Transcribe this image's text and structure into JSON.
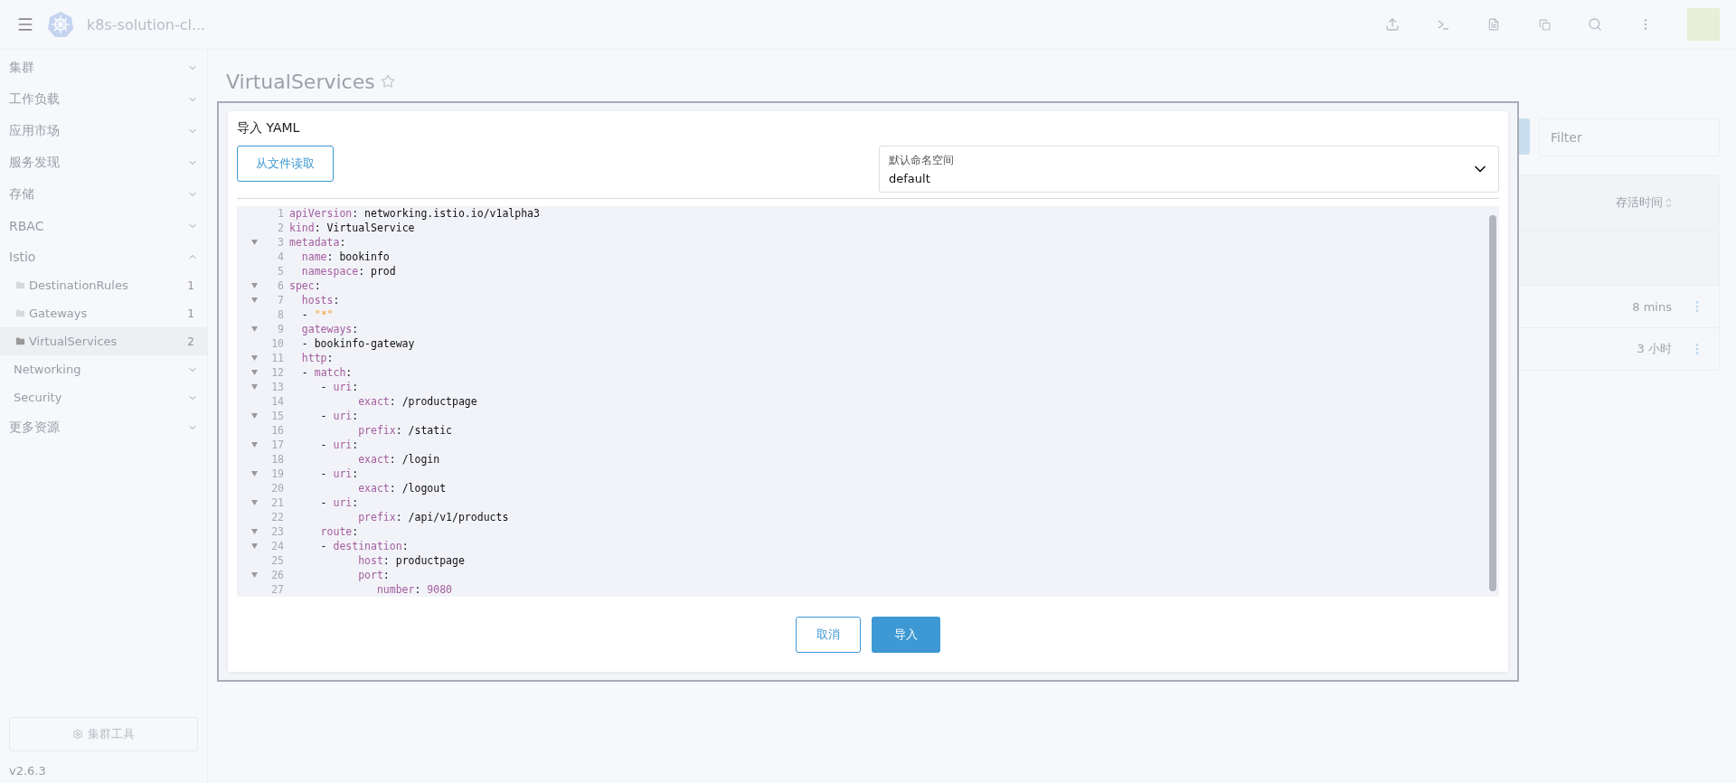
{
  "header": {
    "app_name": "k8s-solution-cl..."
  },
  "sidebar": {
    "items": [
      {
        "label": "集群",
        "expanded": false
      },
      {
        "label": "工作负载",
        "expanded": false
      },
      {
        "label": "应用市场",
        "expanded": false
      },
      {
        "label": "服务发现",
        "expanded": false
      },
      {
        "label": "存储",
        "expanded": false
      },
      {
        "label": "RBAC",
        "expanded": false
      },
      {
        "label": "Istio",
        "expanded": true,
        "children": [
          {
            "kind": "resource",
            "label": "DestinationRules",
            "count": "1",
            "selected": false
          },
          {
            "kind": "resource",
            "label": "Gateways",
            "count": "1",
            "selected": false
          },
          {
            "kind": "resource",
            "label": "VirtualServices",
            "count": "2",
            "selected": true
          },
          {
            "kind": "group",
            "label": "Networking",
            "expanded": false
          },
          {
            "kind": "group",
            "label": "Security",
            "expanded": false
          }
        ]
      },
      {
        "label": "更多资源",
        "expanded": false
      }
    ],
    "tool_button": "集群工具",
    "version": "v2.6.3"
  },
  "page": {
    "title": "VirtualServices",
    "starred": false,
    "filter_placeholder": "Filter",
    "column": "存活时间",
    "rows": [
      {
        "age": "8 mins"
      },
      {
        "age": "3 小时"
      }
    ]
  },
  "modal": {
    "title": "导入 YAML",
    "file_button": "从文件读取",
    "namespace": {
      "label": "默认命名空间",
      "value": "default"
    },
    "lines": [
      {
        "n": "1",
        "fold": false,
        "parts": [
          {
            "kind": "key",
            "text": "apiVersion"
          },
          {
            "kind": "plain",
            "text": ": networking.istio.io/v1alpha3"
          }
        ]
      },
      {
        "n": "2",
        "fold": false,
        "parts": [
          {
            "kind": "key",
            "text": "kind"
          },
          {
            "kind": "plain",
            "text": ": VirtualService"
          }
        ]
      },
      {
        "n": "3",
        "fold": true,
        "parts": [
          {
            "kind": "key",
            "text": "metadata"
          },
          {
            "kind": "plain",
            "text": ":"
          }
        ]
      },
      {
        "n": "4",
        "fold": false,
        "parts": [
          {
            "kind": "key",
            "text": "  name"
          },
          {
            "kind": "plain",
            "text": ": bookinfo"
          }
        ]
      },
      {
        "n": "5",
        "fold": false,
        "parts": [
          {
            "kind": "key",
            "text": "  namespace"
          },
          {
            "kind": "plain",
            "text": ": prod"
          }
        ]
      },
      {
        "n": "6",
        "fold": true,
        "parts": [
          {
            "kind": "key",
            "text": "spec"
          },
          {
            "kind": "plain",
            "text": ":"
          }
        ]
      },
      {
        "n": "7",
        "fold": true,
        "parts": [
          {
            "kind": "key",
            "text": "  hosts"
          },
          {
            "kind": "plain",
            "text": ":"
          }
        ]
      },
      {
        "n": "8",
        "fold": false,
        "parts": [
          {
            "kind": "plain",
            "text": "  - "
          },
          {
            "kind": "string",
            "text": "\"*\""
          }
        ]
      },
      {
        "n": "9",
        "fold": true,
        "parts": [
          {
            "kind": "key",
            "text": "  gateways"
          },
          {
            "kind": "plain",
            "text": ":"
          }
        ]
      },
      {
        "n": "10",
        "fold": false,
        "parts": [
          {
            "kind": "plain",
            "text": "  - bookinfo-gateway"
          }
        ]
      },
      {
        "n": "11",
        "fold": true,
        "parts": [
          {
            "kind": "key",
            "text": "  http"
          },
          {
            "kind": "plain",
            "text": ":"
          }
        ]
      },
      {
        "n": "12",
        "fold": true,
        "parts": [
          {
            "kind": "plain",
            "text": "  - "
          },
          {
            "kind": "key",
            "text": "match"
          },
          {
            "kind": "plain",
            "text": ":"
          }
        ]
      },
      {
        "n": "13",
        "fold": true,
        "parts": [
          {
            "kind": "plain",
            "text": "     - "
          },
          {
            "kind": "key",
            "text": "uri"
          },
          {
            "kind": "plain",
            "text": ":"
          }
        ]
      },
      {
        "n": "14",
        "fold": false,
        "parts": [
          {
            "kind": "key",
            "text": "           exact"
          },
          {
            "kind": "plain",
            "text": ": /productpage"
          }
        ]
      },
      {
        "n": "15",
        "fold": true,
        "parts": [
          {
            "kind": "plain",
            "text": "     - "
          },
          {
            "kind": "key",
            "text": "uri"
          },
          {
            "kind": "plain",
            "text": ":"
          }
        ]
      },
      {
        "n": "16",
        "fold": false,
        "parts": [
          {
            "kind": "key",
            "text": "           prefix"
          },
          {
            "kind": "plain",
            "text": ": /static"
          }
        ]
      },
      {
        "n": "17",
        "fold": true,
        "parts": [
          {
            "kind": "plain",
            "text": "     - "
          },
          {
            "kind": "key",
            "text": "uri"
          },
          {
            "kind": "plain",
            "text": ":"
          }
        ]
      },
      {
        "n": "18",
        "fold": false,
        "parts": [
          {
            "kind": "key",
            "text": "           exact"
          },
          {
            "kind": "plain",
            "text": ": /login"
          }
        ]
      },
      {
        "n": "19",
        "fold": true,
        "parts": [
          {
            "kind": "plain",
            "text": "     - "
          },
          {
            "kind": "key",
            "text": "uri"
          },
          {
            "kind": "plain",
            "text": ":"
          }
        ]
      },
      {
        "n": "20",
        "fold": false,
        "parts": [
          {
            "kind": "key",
            "text": "           exact"
          },
          {
            "kind": "plain",
            "text": ": /logout"
          }
        ]
      },
      {
        "n": "21",
        "fold": true,
        "parts": [
          {
            "kind": "plain",
            "text": "     - "
          },
          {
            "kind": "key",
            "text": "uri"
          },
          {
            "kind": "plain",
            "text": ":"
          }
        ]
      },
      {
        "n": "22",
        "fold": false,
        "parts": [
          {
            "kind": "key",
            "text": "           prefix"
          },
          {
            "kind": "plain",
            "text": ": /api/v1/products"
          }
        ]
      },
      {
        "n": "23",
        "fold": true,
        "parts": [
          {
            "kind": "key",
            "text": "     route"
          },
          {
            "kind": "plain",
            "text": ":"
          }
        ]
      },
      {
        "n": "24",
        "fold": true,
        "parts": [
          {
            "kind": "plain",
            "text": "     - "
          },
          {
            "kind": "key",
            "text": "destination"
          },
          {
            "kind": "plain",
            "text": ":"
          }
        ]
      },
      {
        "n": "25",
        "fold": false,
        "parts": [
          {
            "kind": "key",
            "text": "           host"
          },
          {
            "kind": "plain",
            "text": ": productpage"
          }
        ]
      },
      {
        "n": "26",
        "fold": true,
        "parts": [
          {
            "kind": "key",
            "text": "           port"
          },
          {
            "kind": "plain",
            "text": ":"
          }
        ]
      },
      {
        "n": "27",
        "fold": false,
        "parts": [
          {
            "kind": "key",
            "text": "              number"
          },
          {
            "kind": "plain",
            "text": ": "
          },
          {
            "kind": "number",
            "text": "9080"
          }
        ]
      }
    ],
    "cancel_button": "取消",
    "import_button": "导入"
  }
}
